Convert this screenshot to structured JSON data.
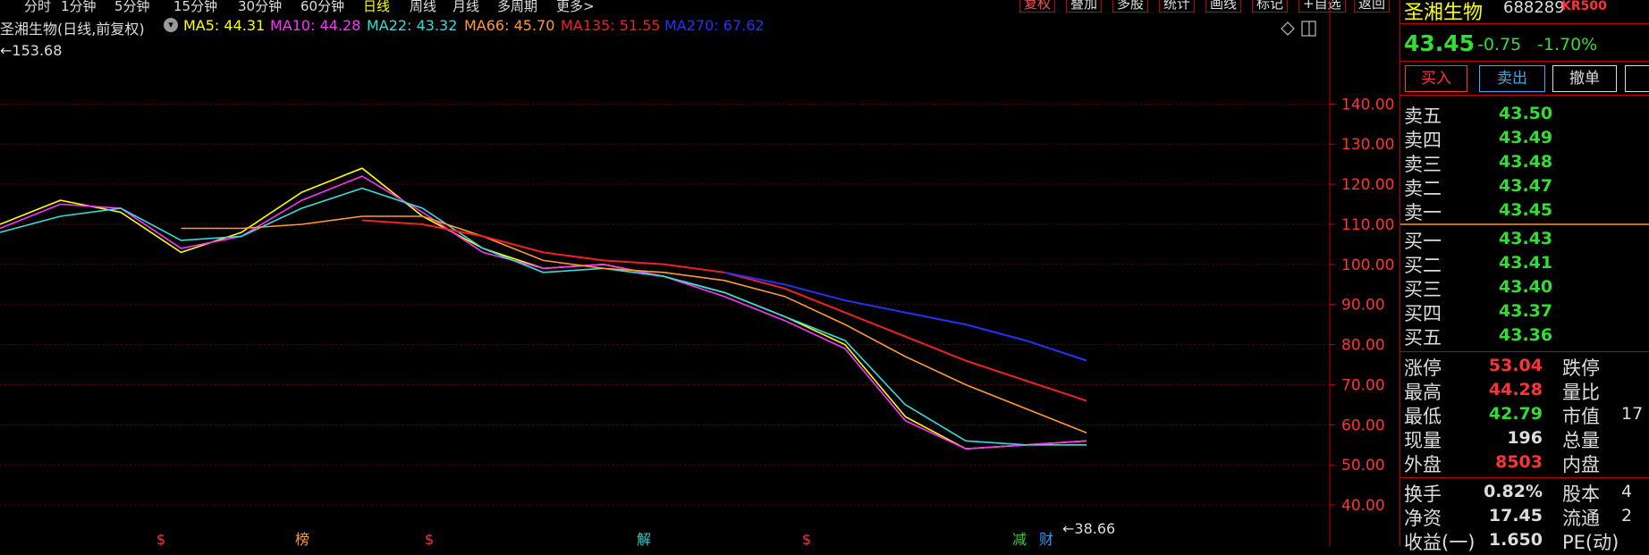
{
  "timeframes": [
    {
      "label": "分时"
    },
    {
      "label": "1分钟"
    },
    {
      "label": "5分钟"
    },
    {
      "label": "15分钟"
    },
    {
      "label": "30分钟"
    },
    {
      "label": "60分钟"
    },
    {
      "label": "日线",
      "active": true
    },
    {
      "label": "周线"
    },
    {
      "label": "月线"
    },
    {
      "label": "多周期"
    },
    {
      "label": "更多>"
    }
  ],
  "tools": [
    "复权",
    "叠加",
    "多股",
    "统计",
    "画线",
    "标记",
    "+自选",
    "返回"
  ],
  "legend": {
    "title": "圣湘生物(日线,前复权)",
    "items": [
      {
        "label": "MA5: 44.31",
        "color": "#ffff00"
      },
      {
        "label": "MA10: 44.28",
        "color": "#ff33ff"
      },
      {
        "label": "MA22: 43.32",
        "color": "#33dddd"
      },
      {
        "label": "MA66: 45.70",
        "color": "#ff9933"
      },
      {
        "label": "MA135: 51.55",
        "color": "#ee2222"
      },
      {
        "label": "MA270: 67.62",
        "color": "#2233ff"
      }
    ]
  },
  "chart_data": {
    "type": "line",
    "ylim": [
      36,
      153.68
    ],
    "y_ticks": [
      "140.00",
      "130.00",
      "120.00",
      "110.00",
      "100.00",
      "90.00",
      "80.00",
      "70.00",
      "60.00",
      "50.00",
      "40.00"
    ],
    "high_label": "153.68",
    "low_label": "38.66",
    "event_markers": [
      "$",
      "榜",
      "$",
      "解",
      "$",
      "减",
      "财"
    ],
    "series": [
      {
        "name": "MA5",
        "color": "#ffff00",
        "x": [
          0,
          20,
          40,
          60,
          80,
          100,
          120,
          140,
          160,
          180,
          200,
          220,
          240,
          260,
          280,
          300,
          320,
          340,
          360
        ],
        "values": [
          110,
          116,
          113,
          103,
          108,
          118,
          124,
          112,
          104,
          99,
          100,
          97,
          93,
          87,
          80,
          62,
          54,
          55,
          56
        ]
      },
      {
        "name": "MA10",
        "color": "#ff33ff",
        "x": [
          0,
          20,
          40,
          60,
          80,
          100,
          120,
          140,
          160,
          180,
          200,
          220,
          240,
          260,
          280,
          300,
          320,
          340,
          360
        ],
        "values": [
          109,
          115,
          114,
          104,
          107,
          116,
          122,
          113,
          103,
          99,
          100,
          97,
          92,
          86,
          79,
          61,
          54,
          55,
          56
        ]
      },
      {
        "name": "MA22",
        "color": "#33dddd",
        "x": [
          0,
          20,
          40,
          60,
          80,
          100,
          120,
          140,
          160,
          180,
          200,
          220,
          240,
          260,
          280,
          300,
          320,
          340,
          360
        ],
        "values": [
          108,
          112,
          114,
          106,
          107,
          114,
          119,
          114,
          104,
          98,
          99,
          97,
          93,
          87,
          81,
          65,
          56,
          55,
          55
        ]
      },
      {
        "name": "MA66",
        "color": "#ff9933",
        "x": [
          60,
          80,
          100,
          120,
          140,
          160,
          180,
          200,
          220,
          240,
          260,
          280,
          300,
          320,
          340,
          360
        ],
        "values": [
          109,
          109,
          110,
          112,
          112,
          107,
          101,
          99,
          98,
          96,
          92,
          85,
          77,
          70,
          64,
          58
        ]
      },
      {
        "name": "MA135",
        "color": "#ee2222",
        "x": [
          120,
          140,
          160,
          180,
          200,
          220,
          240,
          260,
          280,
          300,
          320,
          340,
          360
        ],
        "values": [
          111,
          110,
          107,
          103,
          101,
          100,
          98,
          94,
          88,
          82,
          76,
          71,
          66
        ]
      },
      {
        "name": "MA270",
        "color": "#2233ff",
        "x": [
          240,
          260,
          280,
          300,
          320,
          340,
          360
        ],
        "values": [
          98,
          95,
          91,
          88,
          85,
          81,
          76
        ]
      }
    ]
  },
  "panel": {
    "name": "圣湘生物",
    "code": "688289",
    "tag": "KR500",
    "price": "43.45",
    "change": "-0.75",
    "change_pct": "-1.70%",
    "buy_label": "买入",
    "sell_label": "卖出",
    "cancel_label": "撤单",
    "asks": [
      {
        "label": "卖五",
        "price": "43.50"
      },
      {
        "label": "卖四",
        "price": "43.49"
      },
      {
        "label": "卖三",
        "price": "43.48"
      },
      {
        "label": "卖二",
        "price": "43.47"
      },
      {
        "label": "卖一",
        "price": "43.45"
      }
    ],
    "bids": [
      {
        "label": "买一",
        "price": "43.43"
      },
      {
        "label": "买二",
        "price": "43.41"
      },
      {
        "label": "买三",
        "price": "43.40"
      },
      {
        "label": "买四",
        "price": "43.37"
      },
      {
        "label": "买五",
        "price": "43.36"
      }
    ],
    "stats": [
      {
        "label": "涨停",
        "value": "53.04",
        "color": "#ff3333",
        "label2": "跌停",
        "value2": ""
      },
      {
        "label": "最高",
        "value": "44.28",
        "color": "#ff3333",
        "label2": "量比",
        "value2": ""
      },
      {
        "label": "最低",
        "value": "42.79",
        "color": "#33dd33",
        "label2": "市值",
        "value2": "17"
      },
      {
        "label": "现量",
        "value": "196",
        "color": "#ddd",
        "label2": "总量",
        "value2": ""
      },
      {
        "label": "外盘",
        "value": "8503",
        "color": "#ff3333",
        "label2": "内盘",
        "value2": ""
      }
    ],
    "stats2": [
      {
        "label": "换手",
        "value": "0.82%",
        "label2": "股本",
        "value2": "4"
      },
      {
        "label": "净资",
        "value": "17.45",
        "label2": "流通",
        "value2": "2"
      },
      {
        "label": "收益(一)",
        "value": "1.650",
        "label2": "PE(动)",
        "value2": ""
      }
    ]
  }
}
